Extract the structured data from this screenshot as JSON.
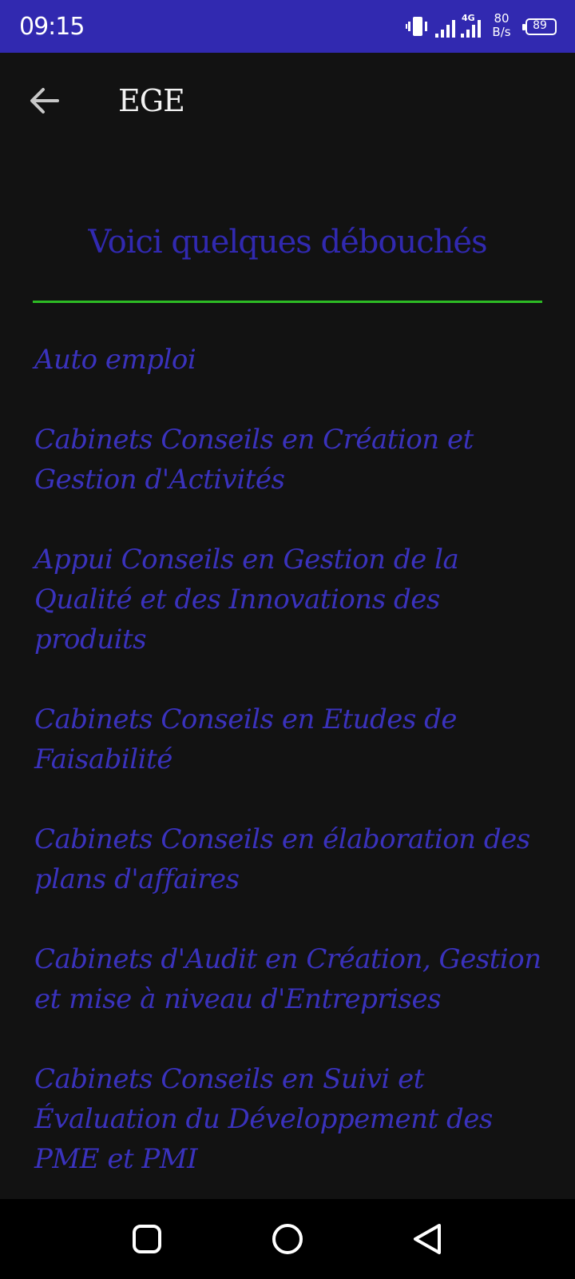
{
  "status_bar": {
    "time": "09:15",
    "network": "4G",
    "net_speed_value": "80",
    "net_speed_unit": "B/s",
    "battery": "89",
    "background": "#3129b0"
  },
  "toolbar": {
    "back_icon": "arrow-left-icon",
    "title": "EGE"
  },
  "content": {
    "heading": "Voici quelques débouchés",
    "divider_color": "#2dbb24",
    "text_color": "#3a32bd",
    "items": [
      "Auto emploi",
      "Cabinets Conseils en Création et Gestion d'Activités",
      "Appui Conseils en Gestion de la Qualité et des Innovations des produits",
      "Cabinets Conseils en Etudes de Faisabilité",
      "Cabinets Conseils en élaboration des plans d'affaires",
      "Cabinets d'Audit en Création, Gestion et mise à niveau d'Entreprises",
      "Cabinets Conseils en Suivi et Évaluation du Développement des PME et PMI"
    ]
  },
  "nav_bar": {
    "recents_icon": "square-icon",
    "home_icon": "circle-icon",
    "back_icon": "triangle-back-icon"
  }
}
